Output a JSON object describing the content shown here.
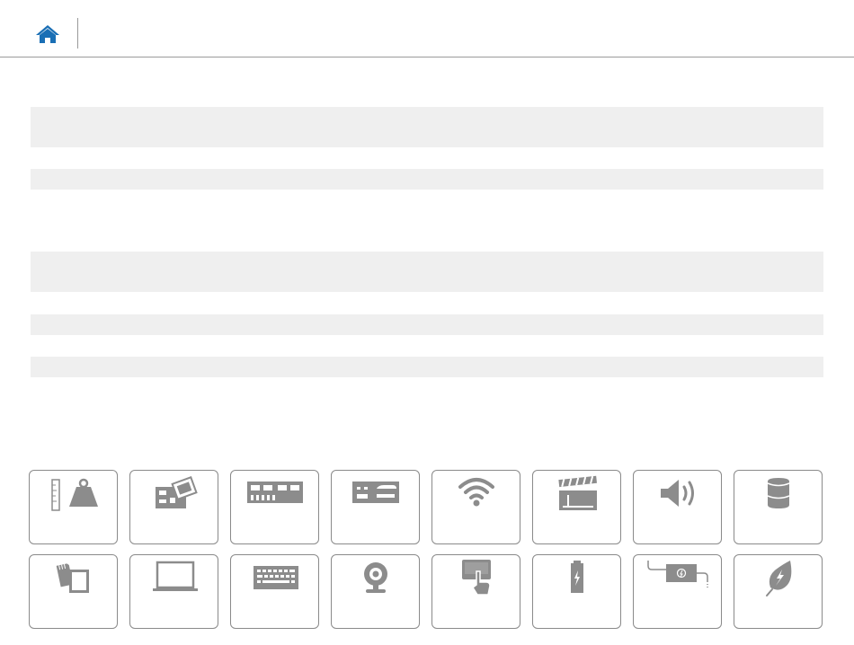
{
  "header": {
    "home_icon": "home-icon",
    "accent_color": "#1a6fb5"
  },
  "tiles": [
    {
      "name": "dimensions-weight-tile",
      "icon": "ruler-weight-icon"
    },
    {
      "name": "system-board-tile",
      "icon": "motherboard-icon"
    },
    {
      "name": "memory-tile",
      "icon": "memory-module-icon"
    },
    {
      "name": "ports-connectors-tile",
      "icon": "ports-icon"
    },
    {
      "name": "communications-tile",
      "icon": "wifi-icon"
    },
    {
      "name": "video-tile",
      "icon": "clapperboard-icon"
    },
    {
      "name": "audio-tile",
      "icon": "speaker-icon"
    },
    {
      "name": "storage-tile",
      "icon": "storage-drive-icon"
    },
    {
      "name": "media-card-reader-tile",
      "icon": "sd-card-icon"
    },
    {
      "name": "display-tile",
      "icon": "laptop-icon"
    },
    {
      "name": "keyboard-tile",
      "icon": "keyboard-icon"
    },
    {
      "name": "camera-tile",
      "icon": "webcam-icon"
    },
    {
      "name": "touchpad-tile",
      "icon": "touchpad-icon"
    },
    {
      "name": "battery-tile",
      "icon": "battery-icon"
    },
    {
      "name": "power-adapter-tile",
      "icon": "power-adapter-icon"
    },
    {
      "name": "environmental-tile",
      "icon": "leaf-icon"
    }
  ],
  "icon_color": "#8c8c8c",
  "band_color": "#efefef"
}
